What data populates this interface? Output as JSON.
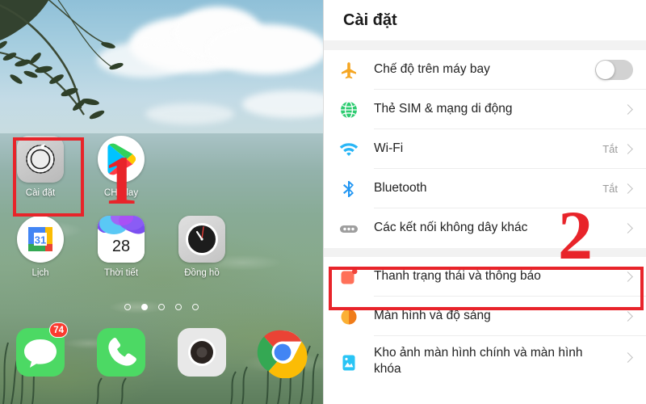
{
  "home": {
    "apps_row1": [
      {
        "name": "Cài đặt",
        "icon": "settings-gear-icon"
      },
      {
        "name": "CH Play",
        "icon": "google-play-icon"
      }
    ],
    "apps_row2": [
      {
        "name": "Lịch",
        "icon": "google-calendar-icon",
        "day": "31"
      },
      {
        "name": "Thời tiết",
        "icon": "weather-icon",
        "day": "28"
      },
      {
        "name": "Đồng hồ",
        "icon": "clock-icon"
      }
    ],
    "dock": [
      {
        "name": "messages-app-icon",
        "badge": "74"
      },
      {
        "name": "phone-app-icon",
        "badge": ""
      },
      {
        "name": "camera-app-icon",
        "badge": ""
      },
      {
        "name": "chrome-app-icon",
        "badge": ""
      }
    ],
    "page_dots": {
      "count": 5,
      "active_index": 1
    },
    "annotation_step": "1"
  },
  "settings": {
    "title": "Cài đặt",
    "annotation_step": "2",
    "rows": [
      {
        "label": "Chế độ trên máy bay",
        "icon": "airplane-icon",
        "value": "",
        "control": "toggle",
        "toggle_on": false
      },
      {
        "label": "Thẻ SIM & mạng di động",
        "icon": "globe-icon",
        "value": "",
        "control": "chevron"
      },
      {
        "label": "Wi-Fi",
        "icon": "wifi-icon",
        "value": "Tắt",
        "control": "chevron"
      },
      {
        "label": "Bluetooth",
        "icon": "bluetooth-icon",
        "value": "Tắt",
        "control": "chevron"
      },
      {
        "label": "Các kết nối không dây khác",
        "icon": "more-dots-icon",
        "value": "",
        "control": "chevron"
      },
      {
        "label": "Thanh trạng thái và thông báo",
        "icon": "notification-square-icon",
        "value": "",
        "control": "chevron",
        "highlighted": true
      },
      {
        "label": "Màn hình và độ sáng",
        "icon": "brightness-icon",
        "value": "",
        "control": "chevron"
      },
      {
        "label": "Kho ảnh màn hình chính và màn hình khóa",
        "icon": "wallpaper-icon",
        "value": "",
        "control": "chevron"
      }
    ]
  },
  "colors": {
    "accent_red": "#e8242a",
    "airplane": "#f5a623",
    "globe": "#2ecc71",
    "wifi": "#29b6f6",
    "bluetooth": "#2196f3",
    "dots": "#9e9e9e",
    "notification": "#ff7059",
    "brightness": "#f7a716",
    "wallpaper_icon": "#29c4f5"
  }
}
